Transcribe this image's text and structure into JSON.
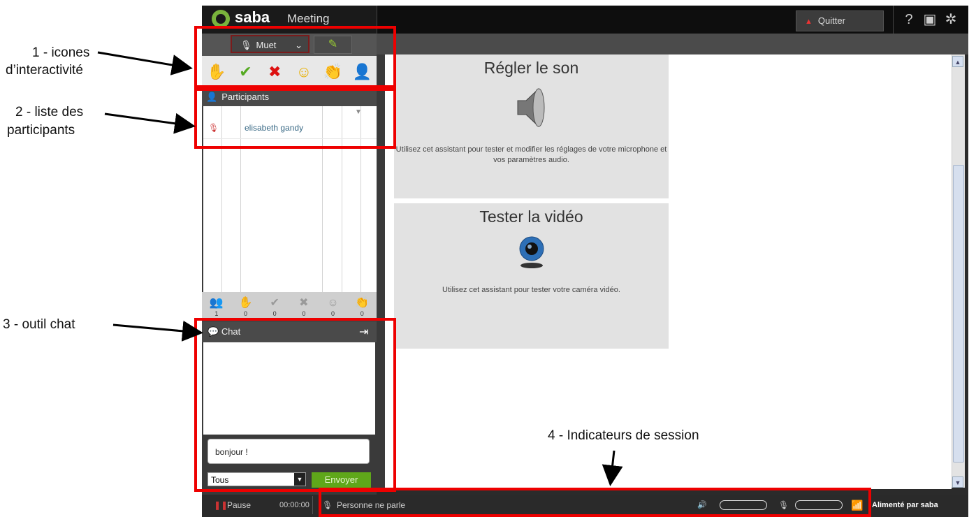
{
  "app": {
    "brand": "saba",
    "brand_sub": "Meeting",
    "quit_label": "Quitter",
    "help_icon": "question-icon",
    "layout_icon": "layout-icon",
    "settings_icon": "gear-icon"
  },
  "controls": {
    "mute_label": "Muet",
    "icons": [
      "raise-hand-icon",
      "check-icon",
      "cross-icon",
      "smiley-icon",
      "applause-icon",
      "user-leave-icon"
    ]
  },
  "participants": {
    "title": "Participants",
    "items": [
      {
        "name": "elisabeth gandy"
      }
    ],
    "counts": [
      "1",
      "0",
      "0",
      "0",
      "0",
      "0"
    ]
  },
  "chat": {
    "title": "Chat",
    "input_value": "bonjour !",
    "recipient": "Tous",
    "send_label": "Envoyer"
  },
  "content": {
    "cards": [
      {
        "title": "Régler le son",
        "text": "Utilisez cet assistant pour tester et modifier les réglages de votre microphone et vos paramètres audio.",
        "icon": "speaker-icon"
      },
      {
        "title": "Tester la vidéo",
        "text": "Utilisez cet assistant pour tester votre caméra vidéo.",
        "icon": "webcam-icon"
      }
    ]
  },
  "status": {
    "pause_label": "Pause",
    "time": "00:00:00",
    "speaker_text": "Personne ne parle",
    "powered_by": "Alimenté par saba"
  },
  "annotations": {
    "a1_line1": "1 - icones",
    "a1_line2": "d’interactivité",
    "a2_line1": "2 - liste des",
    "a2_line2": "participants",
    "a3": "3 - outil chat",
    "a4": "4 - Indicateurs de session"
  },
  "colors": {
    "accent_red": "#e00000",
    "send_green": "#5fa71a",
    "brand_green": "#7ab43c"
  }
}
